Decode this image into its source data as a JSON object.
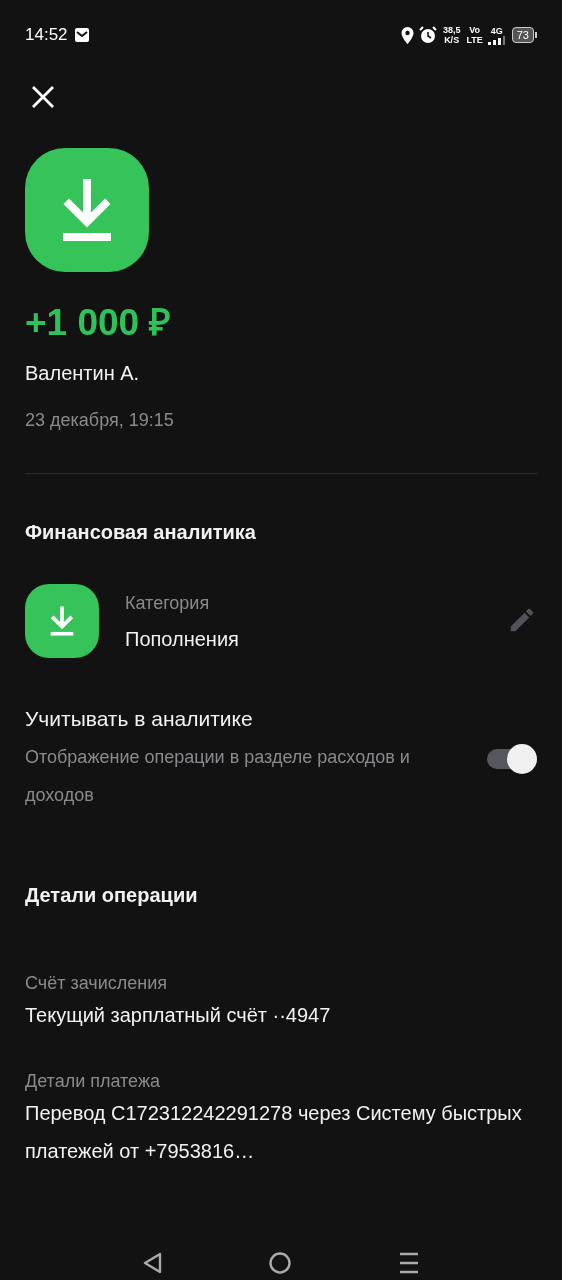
{
  "status_bar": {
    "time": "14:52",
    "speed_value": "38,5",
    "speed_unit": "K/S",
    "volte_top": "Vo",
    "volte_bottom": "LTE",
    "network": "4G",
    "battery": "73"
  },
  "amount": "+1 000 ₽",
  "sender": "Валентин А.",
  "date": "23 декабря, 19:15",
  "analytics": {
    "title": "Финансовая аналитика",
    "category_label": "Категория",
    "category_value": "Пополнения",
    "toggle_title": "Учитывать в аналитике",
    "toggle_description": "Отображение операции в разделе расходов и доходов",
    "on": true
  },
  "details": {
    "title": "Детали операции",
    "fields": [
      {
        "label": "Счёт зачисления",
        "value": "Текущий зарплатный счёт ··4947"
      },
      {
        "label": "Детали платежа",
        "value": "Перевод C172312242291278 через Систему быстрых платежей от +7953816…"
      }
    ]
  }
}
